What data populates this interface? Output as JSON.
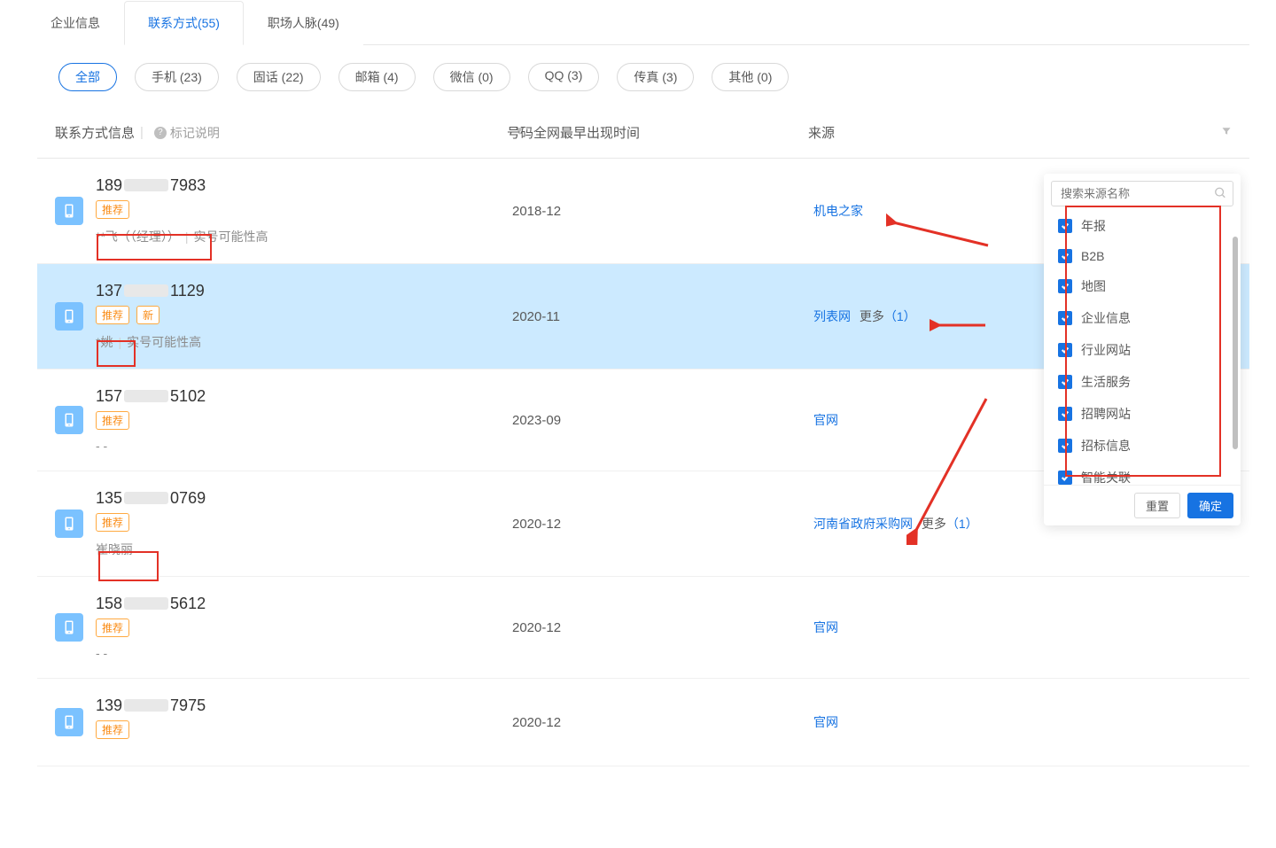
{
  "tabs": [
    {
      "label": "企业信息",
      "active": false
    },
    {
      "label": "联系方式(55)",
      "active": true
    },
    {
      "label": "职场人脉(49)",
      "active": false
    }
  ],
  "pills": [
    {
      "label": "全部",
      "active": true
    },
    {
      "label": "手机 (23)",
      "active": false
    },
    {
      "label": "固话 (22)",
      "active": false
    },
    {
      "label": "邮箱 (4)",
      "active": false
    },
    {
      "label": "微信 (0)",
      "active": false
    },
    {
      "label": "QQ (3)",
      "active": false
    },
    {
      "label": "传真 (3)",
      "active": false
    },
    {
      "label": "其他 (0)",
      "active": false
    }
  ],
  "table": {
    "headers": {
      "info": "联系方式信息",
      "help": "标记说明",
      "date": "号码全网最早出现时间",
      "source": "来源"
    }
  },
  "rows": [
    {
      "phone_prefix": "189",
      "phone_suffix": "7983",
      "badges": [
        "推荐"
      ],
      "meta_name": "**飞（（经理））",
      "meta_extra": "实号可能性高",
      "date": "2018-12",
      "source": "机电之家",
      "more": null,
      "selected": false
    },
    {
      "phone_prefix": "137",
      "phone_suffix": "1129",
      "badges": [
        "推荐",
        "新"
      ],
      "meta_name": "*姚",
      "meta_extra": "实号可能性高",
      "date": "2020-11",
      "source": "列表网",
      "more": "更多（1）",
      "selected": true
    },
    {
      "phone_prefix": "157",
      "phone_suffix": "5102",
      "badges": [
        "推荐"
      ],
      "meta_name": "- -",
      "meta_extra": "",
      "date": "2023-09",
      "source": "官网",
      "more": null,
      "selected": false
    },
    {
      "phone_prefix": "135",
      "phone_suffix": "0769",
      "badges": [
        "推荐"
      ],
      "meta_name": "崔晓丽",
      "meta_extra": "",
      "date": "2020-12",
      "source": "河南省政府采购网",
      "more": "更多（1）",
      "selected": false
    },
    {
      "phone_prefix": "158",
      "phone_suffix": "5612",
      "badges": [
        "推荐"
      ],
      "meta_name": "- -",
      "meta_extra": "",
      "date": "2020-12",
      "source": "官网",
      "more": null,
      "selected": false
    },
    {
      "phone_prefix": "139",
      "phone_suffix": "7975",
      "badges": [
        "推荐"
      ],
      "meta_name": "",
      "meta_extra": "",
      "date": "2020-12",
      "source": "官网",
      "more": null,
      "selected": false
    }
  ],
  "dropdown": {
    "search_placeholder": "搜索来源名称",
    "items": [
      "年报",
      "B2B",
      "地图",
      "企业信息",
      "行业网站",
      "生活服务",
      "招聘网站",
      "招标信息",
      "智能关联"
    ],
    "reset": "重置",
    "confirm": "确定"
  }
}
